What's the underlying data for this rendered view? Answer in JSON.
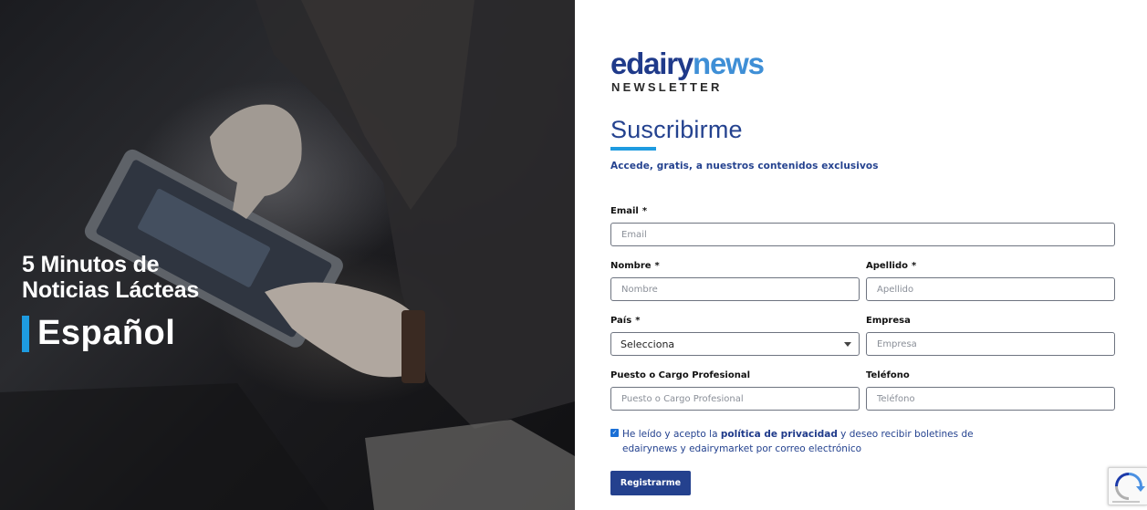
{
  "hero": {
    "line1": "5 Minutos de",
    "line2": "Noticias Lácteas",
    "language": "Español"
  },
  "brand": {
    "logo_part1": "edairy",
    "logo_part2": "news",
    "tagline": "NEWSLETTER"
  },
  "form": {
    "title": "Suscribirme",
    "subtitle": "Accede, gratis, a nuestros contenidos exclusivos",
    "required_mark": "*",
    "email": {
      "label": "Email",
      "placeholder": "Email"
    },
    "nombre": {
      "label": "Nombre",
      "placeholder": "Nombre"
    },
    "apellido": {
      "label": "Apellido",
      "placeholder": "Apellido"
    },
    "pais": {
      "label": "País",
      "selected": "Selecciona"
    },
    "empresa": {
      "label": "Empresa",
      "placeholder": "Empresa"
    },
    "puesto": {
      "label": "Puesto o Cargo Profesional",
      "placeholder": "Puesto o Cargo Profesional"
    },
    "telefono": {
      "label": "Teléfono",
      "placeholder": "Teléfono"
    },
    "consent": {
      "checked": true,
      "text_before": "He leído y acepto la ",
      "link_text": "política de privacidad",
      "text_after": " y deseo recibir boletines de edairynews y edairymarket por correo electrónico"
    },
    "submit_label": "Registrarme"
  },
  "colors": {
    "brand_dark_blue": "#24428f",
    "brand_light_blue": "#1e9be0",
    "logo_news_blue": "#3f8fd6"
  },
  "icons": {
    "recaptcha": "recaptcha-badge-icon",
    "select_caret": "chevron-down-icon",
    "checkbox": "checkmark-icon"
  }
}
